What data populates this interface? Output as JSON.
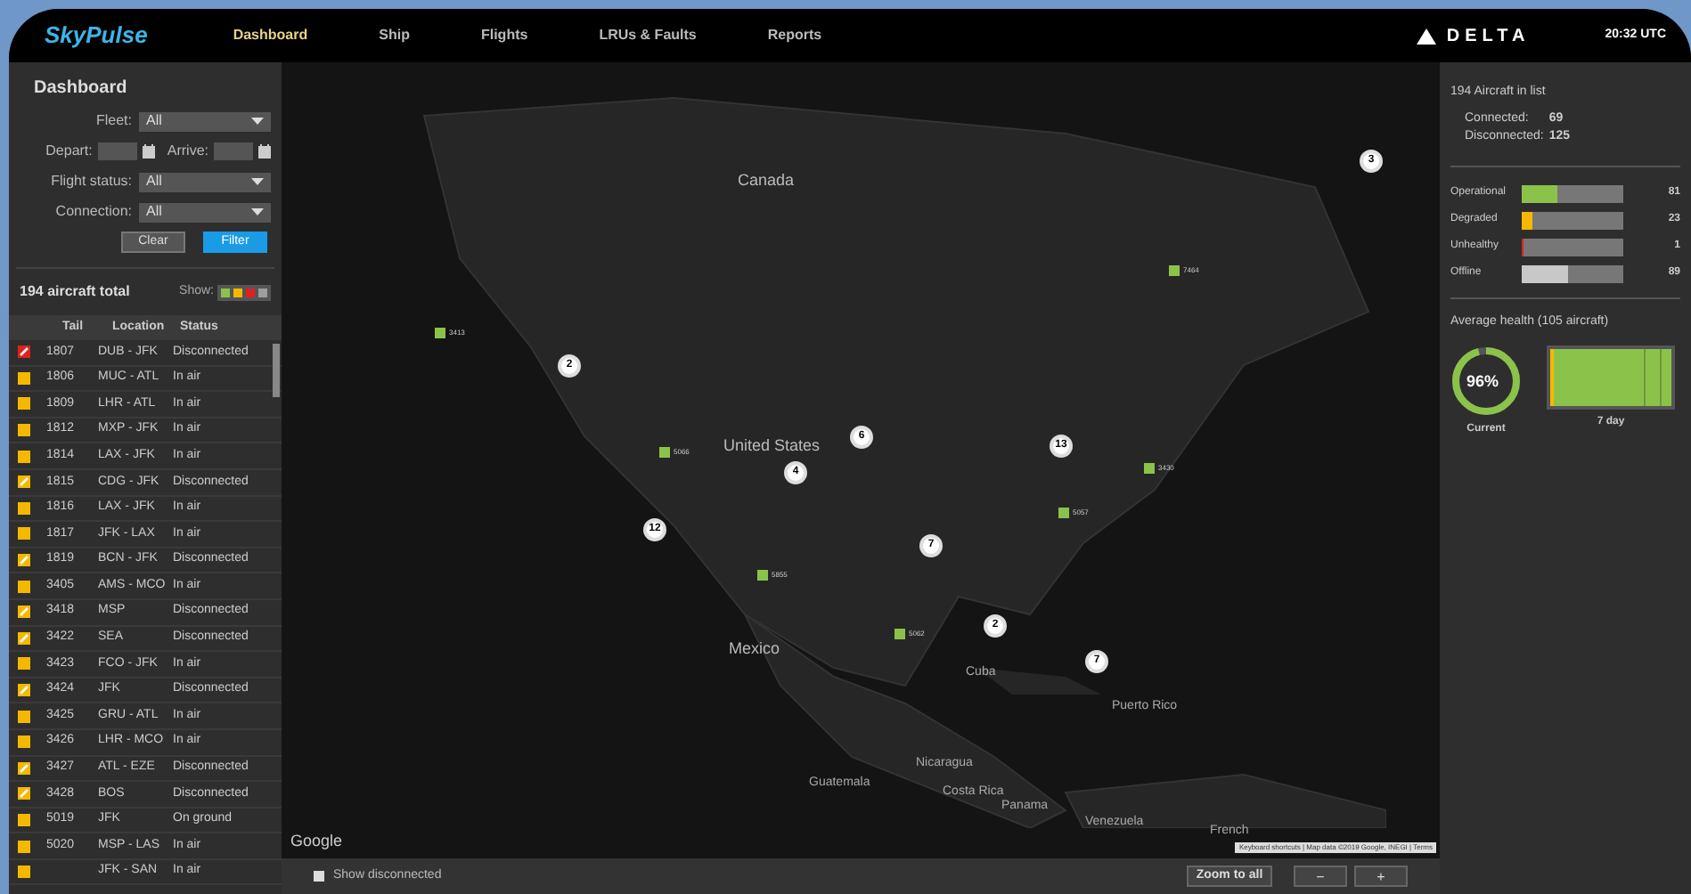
{
  "header": {
    "logo": "SkyPulse",
    "nav": [
      {
        "label": "Dashboard",
        "selected": true
      },
      {
        "label": "Ship",
        "selected": false
      },
      {
        "label": "Flights",
        "selected": false
      },
      {
        "label": "LRUs & Faults",
        "selected": false
      },
      {
        "label": "Reports",
        "selected": false
      }
    ],
    "brand": "DELTA",
    "time": "20:32 UTC"
  },
  "filters": {
    "title": "Dashboard",
    "fleet": {
      "label": "Fleet:",
      "value": "All"
    },
    "depart": {
      "label": "Depart:"
    },
    "arrive": {
      "label": "Arrive:"
    },
    "flight_status": {
      "label": "Flight status:",
      "value": "All"
    },
    "connection": {
      "label": "Connection:",
      "value": "All"
    },
    "clear": "Clear",
    "filter": "Filter"
  },
  "list": {
    "total": "194 aircraft total",
    "show_label": "Show:",
    "show": [
      {
        "color": "#8bc34a",
        "checked": true
      },
      {
        "color": "#f5b800",
        "checked": true
      },
      {
        "color": "#e02020",
        "checked": true
      },
      {
        "color": "#9e9e9e",
        "checked": true
      }
    ],
    "columns": [
      "Tail",
      "Location",
      "Status"
    ],
    "rows": [
      {
        "tail": "1807",
        "location": "DUB - JFK",
        "status": "Disconnected",
        "color": "#e02020",
        "slashed": true
      },
      {
        "tail": "1806",
        "location": "MUC - ATL",
        "status": "In air",
        "color": "#f5b800",
        "slashed": false
      },
      {
        "tail": "1809",
        "location": "LHR - ATL",
        "status": "In air",
        "color": "#f5b800",
        "slashed": false
      },
      {
        "tail": "1812",
        "location": "MXP - JFK",
        "status": "In air",
        "color": "#f5b800",
        "slashed": false
      },
      {
        "tail": "1814",
        "location": "LAX - JFK",
        "status": "In air",
        "color": "#f5b800",
        "slashed": false
      },
      {
        "tail": "1815",
        "location": "CDG - JFK",
        "status": "Disconnected",
        "color": "#f5b800",
        "slashed": true
      },
      {
        "tail": "1816",
        "location": "LAX - JFK",
        "status": "In air",
        "color": "#f5b800",
        "slashed": false
      },
      {
        "tail": "1817",
        "location": "JFK - LAX",
        "status": "In air",
        "color": "#f5b800",
        "slashed": false
      },
      {
        "tail": "1819",
        "location": "BCN - JFK",
        "status": "Disconnected",
        "color": "#f5b800",
        "slashed": true
      },
      {
        "tail": "3405",
        "location": "AMS - MCO",
        "status": "In air",
        "color": "#f5b800",
        "slashed": false
      },
      {
        "tail": "3418",
        "location": "MSP",
        "status": "Disconnected",
        "color": "#f5b800",
        "slashed": true
      },
      {
        "tail": "3422",
        "location": "SEA",
        "status": "Disconnected",
        "color": "#f5b800",
        "slashed": true
      },
      {
        "tail": "3423",
        "location": "FCO - JFK",
        "status": "In air",
        "color": "#f5b800",
        "slashed": false
      },
      {
        "tail": "3424",
        "location": "JFK",
        "status": "Disconnected",
        "color": "#f5b800",
        "slashed": true
      },
      {
        "tail": "3425",
        "location": "GRU - ATL",
        "status": "In air",
        "color": "#f5b800",
        "slashed": false
      },
      {
        "tail": "3426",
        "location": "LHR - MCO",
        "status": "In air",
        "color": "#f5b800",
        "slashed": false
      },
      {
        "tail": "3427",
        "location": "ATL - EZE",
        "status": "Disconnected",
        "color": "#f5b800",
        "slashed": true
      },
      {
        "tail": "3428",
        "location": "BOS",
        "status": "Disconnected",
        "color": "#f5b800",
        "slashed": true
      },
      {
        "tail": "5019",
        "location": "JFK",
        "status": "On ground",
        "color": "#f5b800",
        "slashed": false
      },
      {
        "tail": "5020",
        "location": "MSP - LAS",
        "status": "In air",
        "color": "#f5b800",
        "slashed": false
      },
      {
        "location": "JFK - SAN",
        "status": "In air",
        "color": "#f5b800",
        "slashed": false
      }
    ]
  },
  "map": {
    "labels": [
      "Canada",
      "United States",
      "Mexico",
      "Cuba",
      "Puerto Rico",
      "Guatemala",
      "Nicaragua",
      "Costa Rica",
      "Panama",
      "Venezuela",
      "French"
    ],
    "clusters": [
      "3",
      "2",
      "6",
      "4",
      "13",
      "12",
      "7",
      "2",
      "7"
    ],
    "aircraft": [
      "3413",
      "7464",
      "5066",
      "3430",
      "5057",
      "5855",
      "5062"
    ],
    "attribution": "Google",
    "footer": "Keyboard shortcuts | Map data ©2019 Google, INEGI | Terms"
  },
  "bottom_bar": {
    "show_disconnected": {
      "label": "Show disconnected",
      "checked": false
    },
    "zoom_all": "Zoom to all",
    "zoom_out": "−",
    "zoom_in": "+"
  },
  "summary": {
    "title": "194 Aircraft in list",
    "connected_label": "Connected:",
    "connected": "69",
    "disconnected_label": "Disconnected:",
    "disconnected": "125",
    "health": [
      {
        "label": "Operational",
        "level": 0.35,
        "color": "#8bc34a",
        "count": "81"
      },
      {
        "label": "Degraded",
        "level": 0.1,
        "color": "#f5b800",
        "count": "23"
      },
      {
        "label": "Unhealthy",
        "level": 0.01,
        "color": "#e02020",
        "count": "1"
      },
      {
        "label": "Offline",
        "level": 0.45,
        "color": "#c8c8c8",
        "count": "89"
      }
    ],
    "average": "Average health (105 aircraft)",
    "current": {
      "value": "96%",
      "level": 0.96,
      "label": "Current"
    },
    "week_label": "7 day"
  }
}
